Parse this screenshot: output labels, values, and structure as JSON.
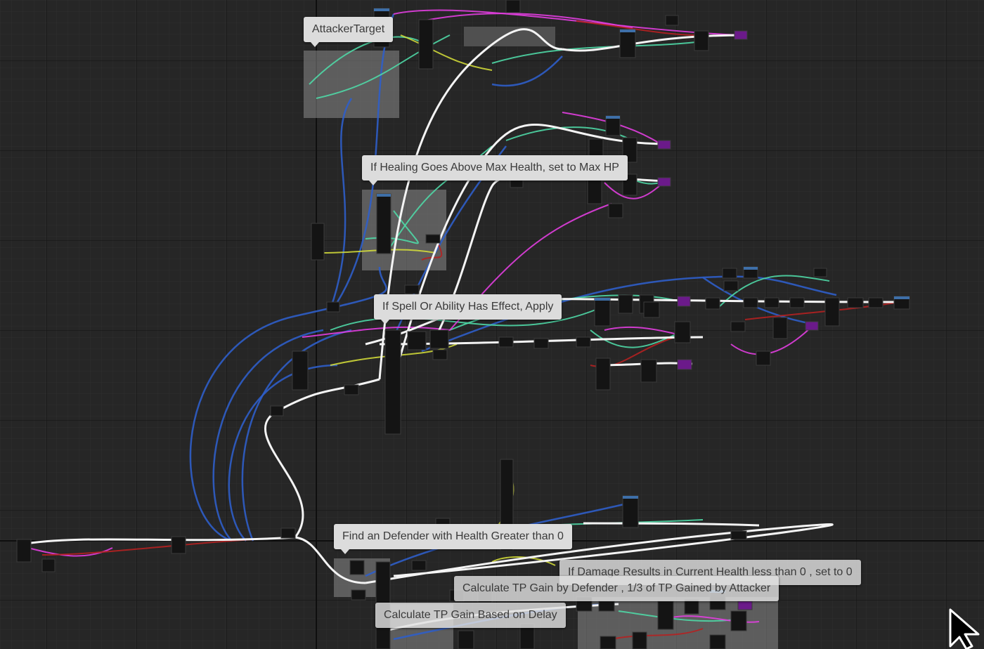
{
  "editor": {
    "view": "Blueprint Event Graph",
    "colors": {
      "background": "#262626",
      "grid_minor": "#2e2e2e",
      "grid_major": "#151515",
      "exec_wire": "#ffffff",
      "object_wire": "#2f5ec9",
      "float_wire": "#4fd8a6",
      "bool_wire": "#b52121",
      "struct_wire": "#e23ee0",
      "vector_wire": "#d8e23a",
      "comment_fill": "#dcdcdc",
      "comment_text": "#3a3a3a",
      "comment_box": "#8a8a8a"
    }
  },
  "comments": [
    {
      "id": "attacker-target",
      "text": "AttackerTarget"
    },
    {
      "id": "healing-max",
      "text": "If Healing Goes Above Max Health, set to Max HP"
    },
    {
      "id": "spell-effect",
      "text": "If Spell Or Ability Has Effect, Apply"
    },
    {
      "id": "find-defender",
      "text": "Find an Defender with Health Greater than 0"
    },
    {
      "id": "damage-zero",
      "text": "If Damage Results in Current Health less than 0 , set to 0"
    },
    {
      "id": "tp-defender",
      "text": "Calculate TP Gain by Defender , 1/3 of TP Gained by Attacker"
    },
    {
      "id": "tp-delay",
      "text": "Calculate TP Gain Based on Delay"
    }
  ],
  "cursor": {
    "icon": "arrow-pointer-icon"
  }
}
